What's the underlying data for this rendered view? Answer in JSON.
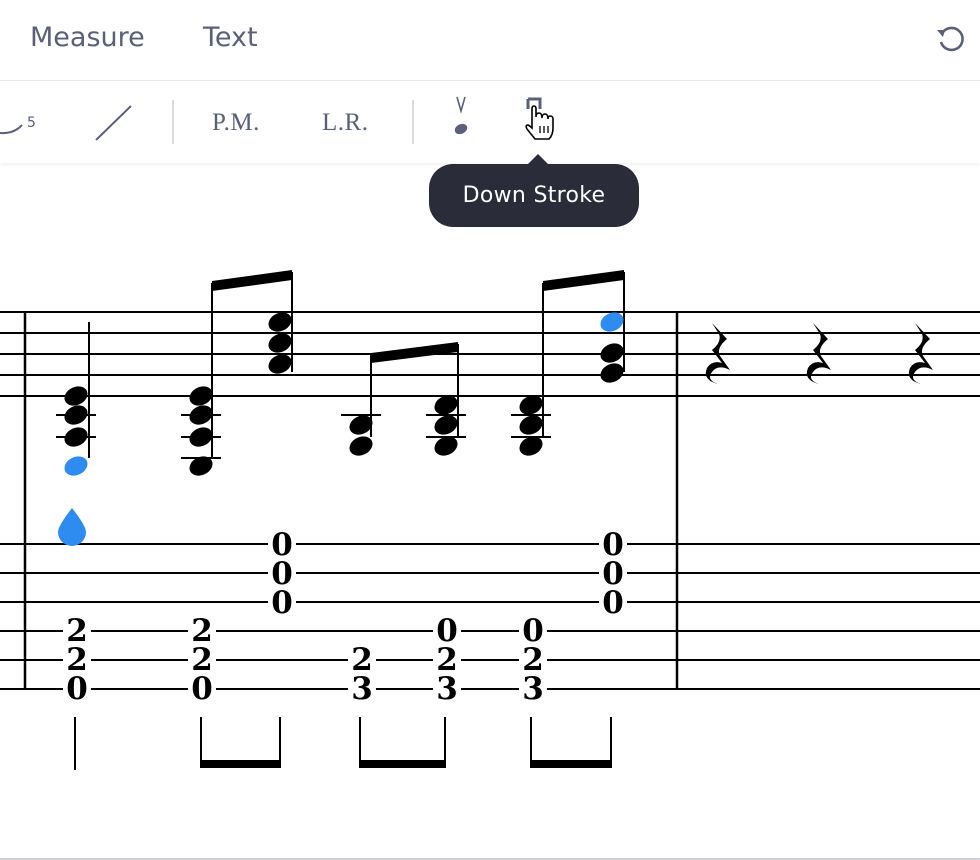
{
  "menu": {
    "tabs": [
      {
        "label": "Measure"
      },
      {
        "label": "Text"
      }
    ]
  },
  "toolbar": {
    "tuplet_number": "5",
    "palm_mute_label": "P.M.",
    "let_ring_label": "L.R.",
    "upstroke_icon": "up-stroke-icon",
    "downstroke_icon": "down-stroke-icon",
    "tooltip": "Down Stroke"
  },
  "score": {
    "tab_frets": [
      {
        "beat": 1,
        "notes": [
          "2",
          "2",
          "0"
        ]
      },
      {
        "beat": 2,
        "notes": [
          "2",
          "2",
          "0"
        ]
      },
      {
        "beat": 3,
        "notes": [
          "0",
          "0",
          "0"
        ]
      },
      {
        "beat": 4,
        "notes": [
          "2",
          "3"
        ]
      },
      {
        "beat": 5,
        "notes": [
          "0",
          "2",
          "3"
        ]
      },
      {
        "beat": 6,
        "notes": [
          "0",
          "2",
          "3"
        ]
      },
      {
        "beat": 7,
        "notes": [
          "0",
          "0",
          "0"
        ]
      }
    ]
  },
  "colors": {
    "accent": "#2e8cf0",
    "text_muted": "#5a6079",
    "tooltip_bg": "#2a2c3a"
  }
}
